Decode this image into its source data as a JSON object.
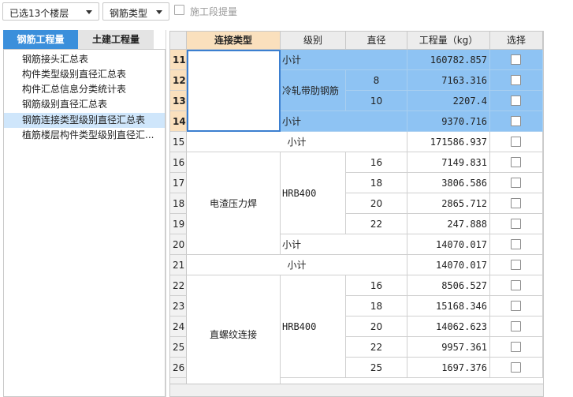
{
  "toolbar": {
    "floors_dropdown": "已选13个楼层",
    "type_dropdown": "钢筋类型",
    "segment_checkbox_label": "施工段提量"
  },
  "tabs": {
    "rebar": "钢筋工程量",
    "civil": "土建工程量"
  },
  "reports": [
    "钢筋接头汇总表",
    "构件类型级别直径汇总表",
    "构件汇总信息分类统计表",
    "钢筋级别直径汇总表",
    "钢筋连接类型级别直径汇总表",
    "植筋楼层构件类型级别直径汇..."
  ],
  "columns": [
    "连接类型",
    "级别",
    "直径",
    "工程量（kg）",
    "选择"
  ],
  "rows": [
    {
      "n": "11",
      "grade": "",
      "dia": "",
      "qty": "160782.857",
      "sub": "小计"
    },
    {
      "n": "12",
      "grade": "",
      "dia": "8",
      "qty": "7163.316",
      "sub": ""
    },
    {
      "n": "13",
      "grade": "",
      "dia": "10",
      "qty": "2207.4",
      "sub": ""
    },
    {
      "n": "14",
      "grade": "",
      "dia": "",
      "qty": "9370.716",
      "sub": "小计"
    },
    {
      "n": "15",
      "grade": "",
      "dia": "",
      "qty": "171586.937",
      "sub": "小计"
    },
    {
      "n": "16",
      "grade": "",
      "dia": "16",
      "qty": "7149.831",
      "sub": ""
    },
    {
      "n": "17",
      "grade": "",
      "dia": "18",
      "qty": "3806.586",
      "sub": ""
    },
    {
      "n": "18",
      "grade": "",
      "dia": "20",
      "qty": "2865.712",
      "sub": ""
    },
    {
      "n": "19",
      "grade": "",
      "dia": "22",
      "qty": "247.888",
      "sub": ""
    },
    {
      "n": "20",
      "grade": "",
      "dia": "",
      "qty": "14070.017",
      "sub": "小计"
    },
    {
      "n": "21",
      "grade": "",
      "dia": "",
      "qty": "14070.017",
      "sub": "小计"
    },
    {
      "n": "22",
      "grade": "",
      "dia": "16",
      "qty": "8506.527",
      "sub": ""
    },
    {
      "n": "23",
      "grade": "",
      "dia": "18",
      "qty": "15168.346",
      "sub": ""
    },
    {
      "n": "24",
      "grade": "",
      "dia": "20",
      "qty": "14062.623",
      "sub": ""
    },
    {
      "n": "25",
      "grade": "",
      "dia": "22",
      "qty": "9957.361",
      "sub": ""
    },
    {
      "n": "26",
      "grade": "",
      "dia": "25",
      "qty": "1697.376",
      "sub": ""
    }
  ],
  "merged": {
    "cold_rolled": "冷轧带肋钢筋",
    "electroslag": "电渣压力焊",
    "hrb400_a": "HRB400",
    "straight_thread": "直螺纹连接",
    "hrb400_b": "HRB400"
  }
}
